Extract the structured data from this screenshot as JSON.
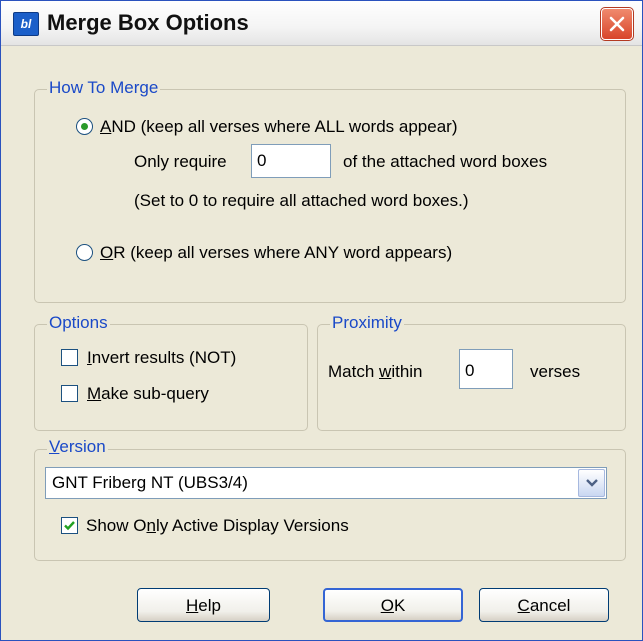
{
  "window": {
    "title": "Merge Box Options",
    "icon": "app-icon"
  },
  "how_to_merge": {
    "title": "How To Merge",
    "and_option": {
      "label_accel": "A",
      "label_rest": "ND (keep all verses where ALL words appear)",
      "selected": true
    },
    "only_require_label": "Only require",
    "only_require_value": "0",
    "attached_label": "of the attached word boxes",
    "hint": "(Set to 0 to require all attached word boxes.)",
    "or_option": {
      "label_accel": "O",
      "label_rest": "R (keep all verses where ANY word appears)",
      "selected": false
    }
  },
  "options": {
    "title": "Options",
    "invert": {
      "label_accel": "I",
      "label_rest": "nvert results (NOT)",
      "checked": false
    },
    "subquery": {
      "label_accel": "M",
      "label_rest": "ake sub-query",
      "checked": false
    }
  },
  "proximity": {
    "title": "Proximity",
    "match_pre": "Match ",
    "match_accel": "w",
    "match_post": "ithin",
    "value": "0",
    "unit": "verses"
  },
  "version": {
    "title_accel": "V",
    "title_rest": "ersion",
    "selected": "GNT Friberg NT (UBS3/4)",
    "show_active": {
      "pre": "Show O",
      "accel": "n",
      "post": "ly Active Display Versions",
      "checked": true
    }
  },
  "buttons": {
    "help": {
      "accel": "H",
      "rest": "elp"
    },
    "ok": {
      "accel": "O",
      "rest": "K"
    },
    "cancel": {
      "accel": "C",
      "rest": "ancel"
    }
  }
}
